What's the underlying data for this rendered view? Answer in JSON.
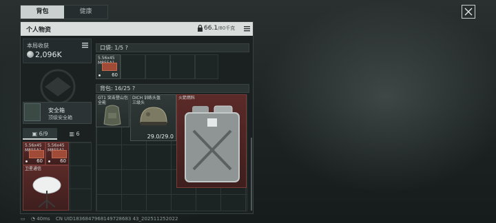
{
  "tabs": [
    {
      "label": "背包"
    },
    {
      "label": "健康"
    }
  ],
  "panel": {
    "title": "个人物资",
    "weight_value": "66.1",
    "weight_capacity": "/80千克"
  },
  "earnings": {
    "label": "本局收获",
    "value": "2,096K"
  },
  "safe_box": {
    "name": "安全箱",
    "subtitle": "顶级安全箱"
  },
  "container_tabs": [
    {
      "label": "6/9"
    },
    {
      "label": "6"
    }
  ],
  "left_items": [
    {
      "name": "5.56x45\nM855A1",
      "count": "60"
    },
    {
      "name": "5.56x45\nM855A1",
      "count": "60"
    },
    {
      "name": "卫星通信",
      "count": ""
    }
  ],
  "pocket": {
    "label": "口袋: 1/5 ?",
    "item": {
      "name": "5.56x45\nM855A1",
      "count": "60"
    }
  },
  "backpack": {
    "label": "背包: 16/25 ?",
    "items": [
      {
        "name": "GT1 突击登山包\n全能",
        "count": ""
      },
      {
        "name": "DICH 训练头盔\n三级头",
        "count": "29.0/29.0"
      },
      {
        "name": "火箭燃料",
        "count": ""
      }
    ]
  },
  "status": {
    "ping": "40ms",
    "session": "CN UID1836847968149728683 43_202511252022"
  },
  "colors": {
    "header_bg": "#d9dedd",
    "item_red": "#5a2a28",
    "panel_bg": "#1b2121"
  }
}
